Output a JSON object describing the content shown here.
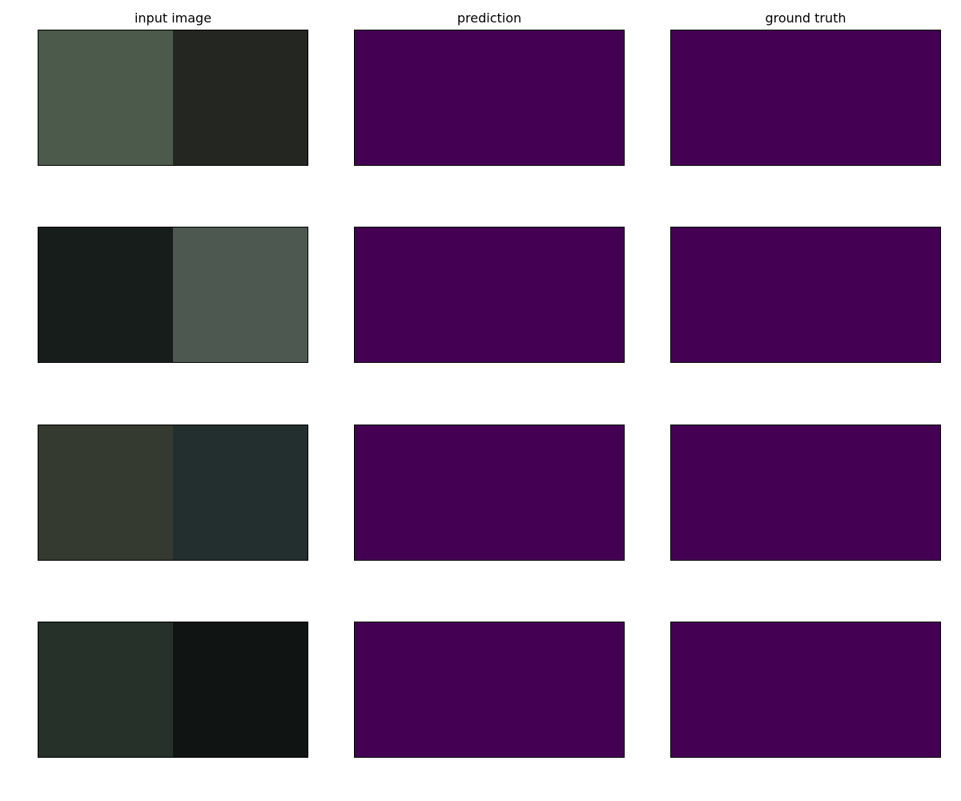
{
  "columns": {
    "input": "input image",
    "prediction": "prediction",
    "ground_truth": "ground truth"
  },
  "colors": {
    "mask": "#440154"
  },
  "rows": [
    {
      "input_left": "#4b5a4a",
      "input_right": "#232621"
    },
    {
      "input_left": "#171d1a",
      "input_right": "#4d5950"
    },
    {
      "input_left": "#343a30",
      "input_right": "#232f2e"
    },
    {
      "input_left": "#253129",
      "input_right": "#101513"
    }
  ]
}
